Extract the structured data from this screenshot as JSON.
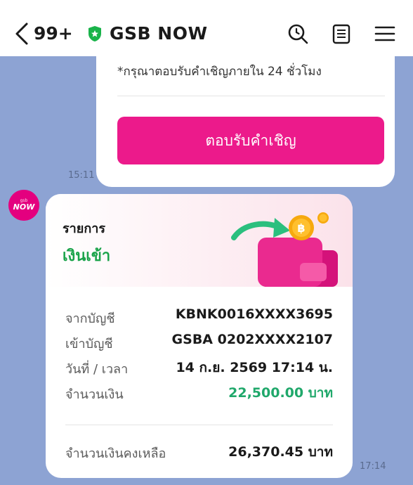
{
  "header": {
    "unread_count": "99+",
    "title": "GSB NOW"
  },
  "previous_message": {
    "note": "*กรุณาตอบรับคำเชิญภายใน 24 ชั่วโมง",
    "accept_button": "ตอบรับคำเชิญ",
    "timestamp": "15:11"
  },
  "sender": {
    "avatar_text": "NOW",
    "avatar_small_text": "gsb"
  },
  "transaction": {
    "heading": "รายการ",
    "type": "เงินเข้า",
    "rows": [
      {
        "label": "จากบัญชี",
        "value": "KBNK0016XXXX3695"
      },
      {
        "label": "เข้าบัญชี",
        "value": "GSBA  0202XXXX2107"
      },
      {
        "label": "วันที่ / เวลา",
        "value": "14 ก.ย. 2569 17:14 น."
      },
      {
        "label": "จำนวนเงิน",
        "value": "22,500.00 บาท"
      }
    ],
    "balance_label": "จำนวนเงินคงเหลือ",
    "balance_value": "26,370.45 บาท",
    "timestamp": "17:14"
  },
  "colors": {
    "accent_pink": "#ec1a8b",
    "income_green": "#1aa34a",
    "chat_background": "#8da3d3"
  }
}
